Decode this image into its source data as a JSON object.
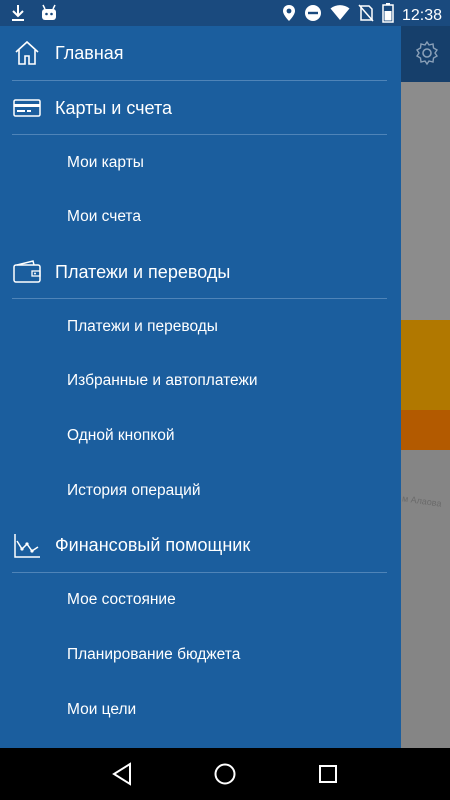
{
  "status_bar": {
    "time": "12:38",
    "icons": [
      "download-icon",
      "android-icon",
      "location-icon",
      "do-not-disturb-icon",
      "wifi-icon",
      "no-sim-icon",
      "battery-icon"
    ]
  },
  "background": {
    "street_label": "Алексея Халтурина",
    "street_label_visible": "м Алаова",
    "settings_icon": "gear-icon"
  },
  "drawer": {
    "items": [
      {
        "type": "section",
        "label": "Главная",
        "icon": "home-icon",
        "divider": true
      },
      {
        "type": "section",
        "label": "Карты и счета",
        "icon": "card-icon",
        "divider": true
      },
      {
        "type": "sub",
        "label": "Мои карты"
      },
      {
        "type": "sub",
        "label": "Мои счета"
      },
      {
        "type": "section",
        "label": "Платежи и переводы",
        "icon": "wallet-icon",
        "divider": true
      },
      {
        "type": "sub",
        "label": "Платежи и переводы"
      },
      {
        "type": "sub",
        "label": "Избранные и автоплатежи"
      },
      {
        "type": "sub",
        "label": "Одной кнопкой"
      },
      {
        "type": "sub",
        "label": "История операций"
      },
      {
        "type": "section",
        "label": "Финансовый помощник",
        "icon": "chart-icon",
        "divider": true
      },
      {
        "type": "sub",
        "label": "Мое состояние"
      },
      {
        "type": "sub",
        "label": "Планирование бюджета"
      },
      {
        "type": "sub",
        "label": "Мои цели"
      }
    ]
  },
  "nav_bar": {
    "buttons": [
      "back-icon",
      "home-circle-icon",
      "recents-icon"
    ]
  },
  "colors": {
    "drawer_bg": "#1b5e9e",
    "status_bar": "#1a4a7e",
    "divider": "#4f84b8"
  }
}
